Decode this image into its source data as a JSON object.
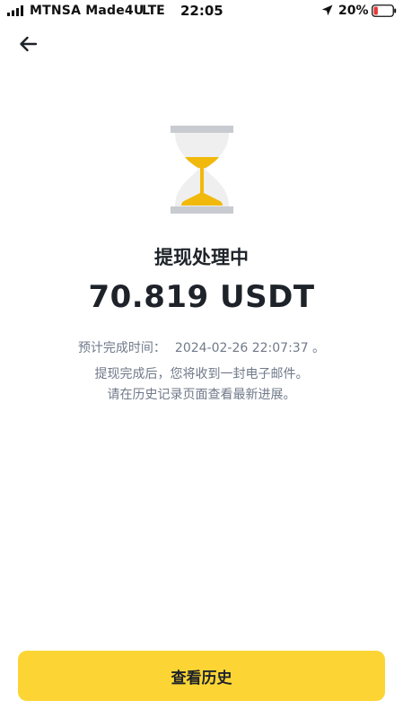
{
  "status_bar": {
    "carrier": "MTNSA Made4U",
    "network": "LTE",
    "time": "22:05",
    "battery_percent": "20%",
    "battery_level": 0.2,
    "battery_color": "#e53935"
  },
  "main": {
    "status_title": "提现处理中",
    "amount": "70.819 USDT",
    "eta_label": "预计完成时间：",
    "eta_value": "2024-02-26 22:07:37 。",
    "note_line1": "提现完成后，您将收到一封电子邮件。",
    "note_line2": "请在历史记录页面查看最新进展。"
  },
  "actions": {
    "view_history_label": "查看历史"
  },
  "colors": {
    "accent": "#fcd535",
    "hourglass_sand": "#f0b90b",
    "hourglass_frame": "#c8cbd0",
    "text_primary": "#1e2329",
    "text_secondary": "#707a8a"
  },
  "icons": {
    "back": "arrow-left-icon",
    "status": "hourglass-icon"
  }
}
